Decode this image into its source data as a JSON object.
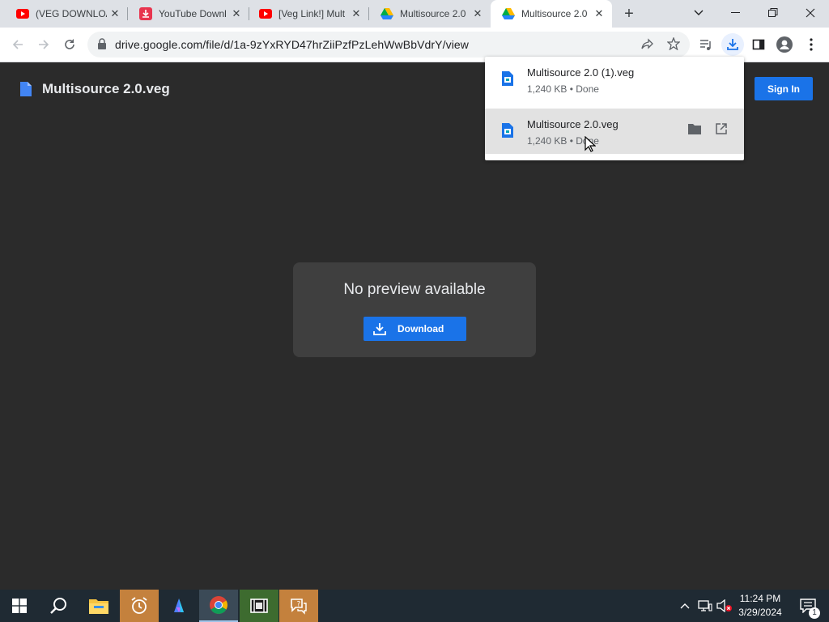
{
  "browser": {
    "tabs": [
      {
        "title": "(VEG DOWNLOAD",
        "icon": "youtube-icon"
      },
      {
        "title": "YouTube Downl",
        "icon": "download-site-icon"
      },
      {
        "title": "[Veg Link!] Mult",
        "icon": "youtube-icon"
      },
      {
        "title": "Multisource 2.0",
        "icon": "google-drive-icon"
      },
      {
        "title": "Multisource 2.0",
        "icon": "google-drive-icon",
        "active": true
      }
    ],
    "url": "drive.google.com/file/d/1a-9zYxRYD47hrZiiPzfPzLehWwBbVdrY/view"
  },
  "page": {
    "file_title": "Multisource 2.0.veg",
    "sign_in": "Sign In",
    "no_preview": "No preview available",
    "download_label": "Download"
  },
  "downloads": [
    {
      "name": "Multisource 2.0 (1).veg",
      "status": "1,240 KB • Done"
    },
    {
      "name": "Multisource 2.0.veg",
      "status": "1,240 KB • Done"
    }
  ],
  "taskbar": {
    "time": "11:24 PM",
    "date": "3/29/2024",
    "notification_count": "1"
  },
  "colors": {
    "accent": "#1a73e8",
    "page_bg": "#2b2b2b",
    "taskbar_bg": "#1f2a33"
  }
}
